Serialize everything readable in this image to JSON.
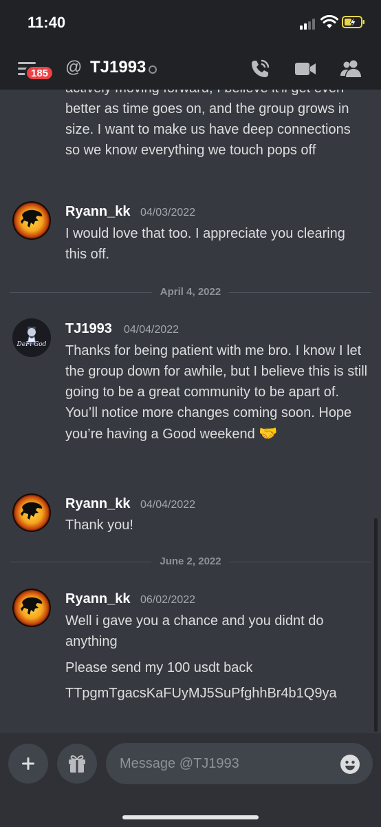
{
  "status_bar": {
    "time": "11:40"
  },
  "header": {
    "notification_count": "185",
    "at_symbol": "@",
    "channel_name": "TJ1993"
  },
  "messages": {
    "partial_top_text": "actively moving forward, I believe it'll get even better as time goes on, and the group grows in size. I want to make us have deep connections so we know everything we touch pops off",
    "divider_april": "April 4, 2022",
    "divider_june": "June 2, 2022",
    "m1": {
      "author": "Ryann_kk",
      "time": "04/03/2022",
      "text": "I would love that too. I appreciate you clearing this off."
    },
    "m2": {
      "author": "TJ1993",
      "time": "04/04/2022",
      "text": "Thanks for being patient with me bro. I know I let the group down for awhile, but I believe this is still going to be a great community to be apart of. You’ll notice more changes coming soon. Hope you’re having a Good weekend",
      "emoji": "🤝",
      "avatar_text": "DeFi God"
    },
    "m3": {
      "author": "Ryann_kk",
      "time": "04/04/2022",
      "text": "Thank you!"
    },
    "m4": {
      "author": "Ryann_kk",
      "time": "06/02/2022",
      "text": "Well i gave you a chance and you didnt do anything"
    },
    "m4_line2": "Please send my 100 usdt back",
    "m4_line3": "TTpgmTgacsKaFUyMJ5SuPfghhBr4b1Q9ya"
  },
  "composer": {
    "placeholder": "Message @TJ1993"
  },
  "colors": {
    "background": "#36393f",
    "header": "#202225",
    "badge": "#ed4245",
    "input": "#40444b"
  },
  "icons": [
    "menu-icon",
    "at-icon",
    "phone-call-icon",
    "video-icon",
    "members-icon",
    "plus-icon",
    "gift-icon",
    "emoji-icon",
    "signal-icon",
    "wifi-icon",
    "battery-icon"
  ]
}
